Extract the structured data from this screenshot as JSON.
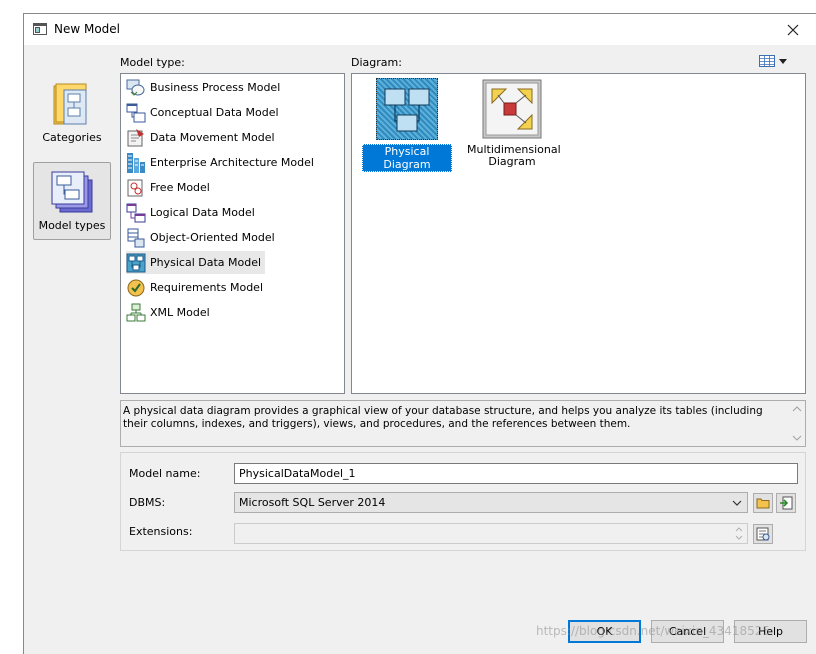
{
  "window": {
    "title": "New Model"
  },
  "labels": {
    "model_type": "Model type:",
    "diagram": "Diagram:"
  },
  "categories": [
    {
      "label": "Categories",
      "selected": false
    },
    {
      "label": "Model types",
      "selected": true
    }
  ],
  "model_types": [
    {
      "label": "Business Process Model",
      "icon": "business-process-icon"
    },
    {
      "label": "Conceptual Data Model",
      "icon": "conceptual-data-icon"
    },
    {
      "label": "Data Movement Model",
      "icon": "data-movement-icon"
    },
    {
      "label": "Enterprise Architecture Model",
      "icon": "enterprise-architecture-icon"
    },
    {
      "label": "Free Model",
      "icon": "free-model-icon"
    },
    {
      "label": "Logical Data Model",
      "icon": "logical-data-icon"
    },
    {
      "label": "Object-Oriented Model",
      "icon": "object-oriented-icon"
    },
    {
      "label": "Physical Data Model",
      "icon": "physical-data-icon",
      "selected": true
    },
    {
      "label": "Requirements Model",
      "icon": "requirements-icon"
    },
    {
      "label": "XML Model",
      "icon": "xml-model-icon"
    }
  ],
  "diagrams": [
    {
      "label": "Physical Diagram",
      "selected": true
    },
    {
      "label_line1": "Multidimensional",
      "label_line2": "Diagram",
      "selected": false
    }
  ],
  "description": "A physical data diagram provides a graphical view of your database structure, and helps you analyze its tables (including their columns, indexes, and triggers), views, and procedures, and the references between them.",
  "form": {
    "model_name_label": "Model name:",
    "model_name_value": "PhysicalDataModel_1",
    "dbms_label": "DBMS:",
    "dbms_value": "Microsoft SQL Server 2014",
    "extensions_label": "Extensions:",
    "extensions_value": ""
  },
  "buttons": {
    "ok": "OK",
    "cancel": "Cancel",
    "help": "Help"
  },
  "watermark": "https://blog.csdn.net/weixin_43418525",
  "colors": {
    "selection": "#0078d7",
    "accent_teal": "#4aa3c8"
  }
}
